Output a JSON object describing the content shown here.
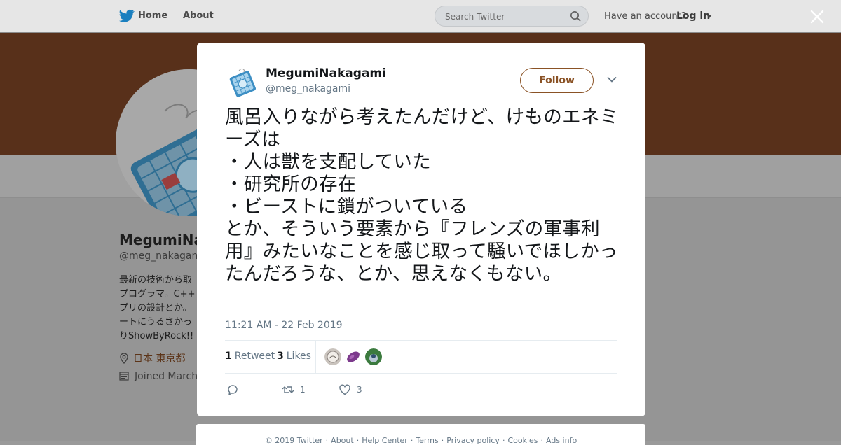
{
  "nav": {
    "home_label": "Home",
    "about_label": "About",
    "search_placeholder": "Search Twitter",
    "have_account": "Have an account?",
    "login_label": "Log in",
    "brand_color": "#1da1f2"
  },
  "profile": {
    "name": "MegumiNakagami",
    "handle": "@meg_nakagami",
    "bio_lines": [
      "最新の技術から取",
      "プログラマ。C++",
      "プリの設計とか。",
      "ートにうるさかっ",
      "りShowByRock!!"
    ],
    "location": "日本 東京都",
    "joined": "Joined March",
    "banner_color": "#58301a"
  },
  "tweet": {
    "author_name": "MegumiNakagami",
    "author_handle": "@meg_nakagami",
    "follow_label": "Follow",
    "text": "風呂入りながら考えたんだけど、けものエネミーズは\n・人は獣を支配していた\n・研究所の存在\n・ビーストに鎖がついている\nとか、そういう要素から『フレンズの軍事利用』みたいなことを感じ取って騒いでほしかったんだろうな、とか、思えなくもない。",
    "timestamp": "11:21 AM - 22 Feb 2019",
    "retweet_count": "1",
    "retweet_label": "Retweet",
    "likes_count": "3",
    "likes_label": "Likes",
    "action_retweet_count": "1",
    "action_like_count": "3",
    "accent_color": "#8a5225"
  },
  "footer": {
    "links": [
      "© 2019 Twitter",
      "About",
      "Help Center",
      "Terms",
      "Privacy policy",
      "Cookies",
      "Ads info"
    ]
  }
}
